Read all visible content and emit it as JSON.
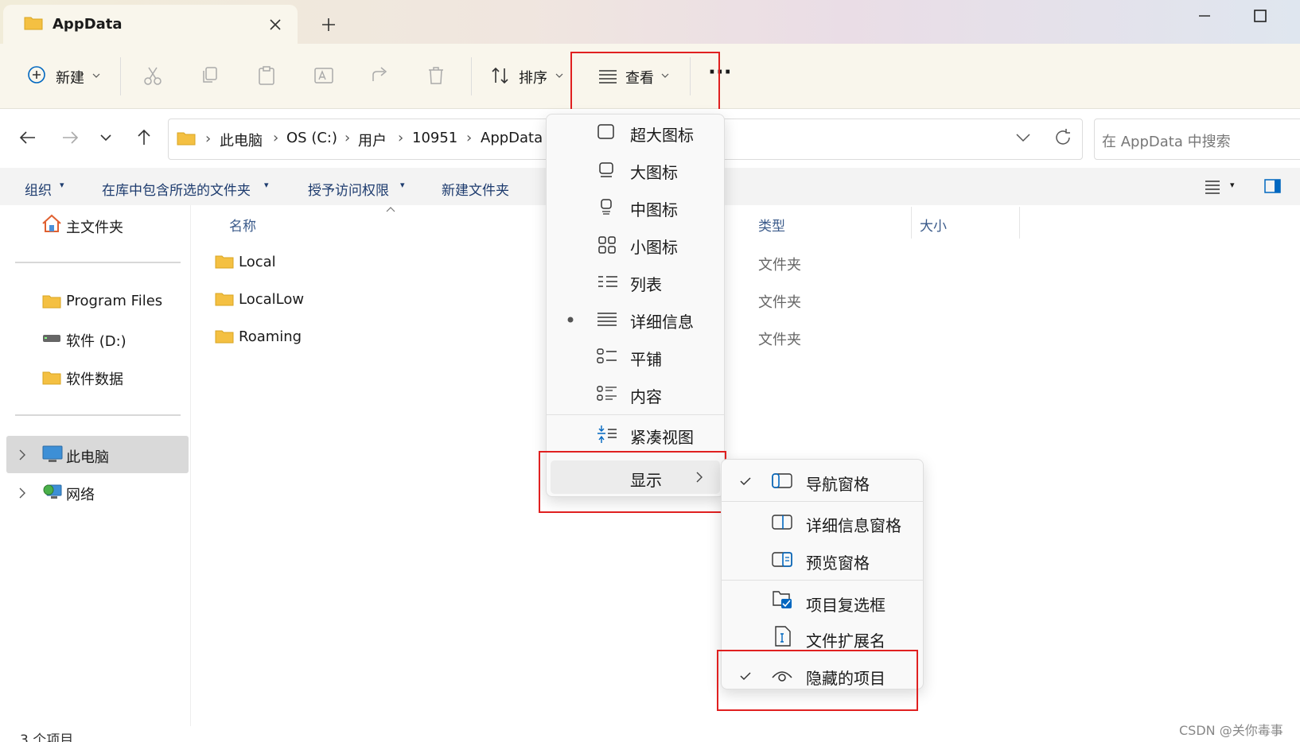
{
  "window": {
    "tab_title": "AppData",
    "icons": {
      "tab": "folder-icon",
      "close": "close-icon",
      "new_tab": "plus-icon",
      "minimize": "minimize-icon",
      "maximize": "maximize-icon"
    }
  },
  "toolbar": {
    "new_label": "新建",
    "sort_label": "排序",
    "view_label": "查看",
    "more_label": "···",
    "icons": [
      "cut-icon",
      "copy-icon",
      "paste-icon",
      "rename-icon",
      "share-icon",
      "delete-icon"
    ]
  },
  "address": {
    "crumbs": [
      "此电脑",
      "OS (C:)",
      "用户",
      "10951",
      "AppData"
    ],
    "search_placeholder": "在 AppData 中搜索"
  },
  "library_bar": {
    "items": [
      "组织",
      "在库中包含所选的文件夹",
      "授予访问权限",
      "新建文件夹"
    ]
  },
  "sidebar": {
    "home": "主文件夹",
    "pinned": [
      "Program Files",
      "软件 (D:)",
      "软件数据"
    ],
    "this_pc": "此电脑",
    "network": "网络"
  },
  "columns": {
    "name": "名称",
    "type": "类型",
    "size": "大小"
  },
  "files": [
    {
      "name": "Local",
      "type": "文件夹"
    },
    {
      "name": "LocalLow",
      "type": "文件夹"
    },
    {
      "name": "Roaming",
      "type": "文件夹"
    }
  ],
  "status": {
    "count": "3 个项目"
  },
  "view_menu": {
    "items": [
      "超大图标",
      "大图标",
      "中图标",
      "小图标",
      "列表",
      "详细信息",
      "平铺",
      "内容"
    ],
    "selected": "详细信息",
    "compact": "紧凑视图",
    "show": "显示"
  },
  "show_menu": {
    "items": [
      "导航窗格",
      "详细信息窗格",
      "预览窗格",
      "项目复选框",
      "文件扩展名",
      "隐藏的项目"
    ],
    "checked": [
      "导航窗格",
      "项目复选框",
      "隐藏的项目"
    ]
  },
  "watermark": "CSDN @关你毒事",
  "colors": {
    "accent": "#0067c0",
    "highlight_red": "#e02020",
    "folder": "#f4c042"
  }
}
